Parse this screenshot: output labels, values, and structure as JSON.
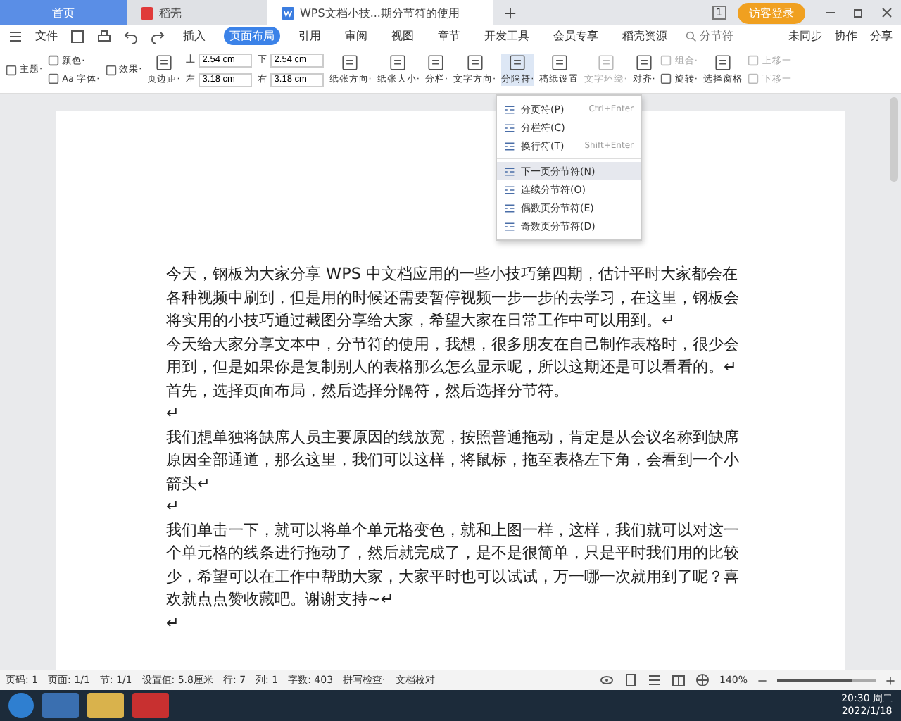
{
  "tabs": [
    {
      "label": "首页",
      "kind": "home",
      "selected": false
    },
    {
      "label": "稻壳",
      "kind": "app",
      "selected": false
    },
    {
      "label": "WPS文档小技...期分节符的使用",
      "kind": "doc",
      "selected": true
    }
  ],
  "title_bar": {
    "page_badge": "1",
    "login": "访客登录"
  },
  "menu_bar": {
    "file": "文件",
    "tabs": [
      {
        "label": "插入",
        "selected": false
      },
      {
        "label": "页面布局",
        "selected": true
      },
      {
        "label": "引用",
        "selected": false
      },
      {
        "label": "审阅",
        "selected": false
      },
      {
        "label": "视图",
        "selected": false
      },
      {
        "label": "章节",
        "selected": false
      },
      {
        "label": "开发工具",
        "selected": false
      },
      {
        "label": "会员专享",
        "selected": false
      },
      {
        "label": "稻壳资源",
        "selected": false
      }
    ],
    "search": {
      "placeholder": "分节符"
    },
    "actions": [
      "未同步",
      "协作",
      "分享"
    ]
  },
  "ribbon": [
    {
      "kind": "stack",
      "items": [
        {
          "label": "主题·",
          "disabled": false
        }
      ]
    },
    {
      "kind": "stack",
      "items": [
        {
          "label": "颜色·",
          "disabled": false
        },
        {
          "label": "Aa 字体·",
          "disabled": false
        }
      ]
    },
    {
      "kind": "stack",
      "items": [
        {
          "label": "效果·",
          "disabled": false
        }
      ]
    },
    {
      "kind": "big",
      "label": "页边距·",
      "disabled": false
    },
    {
      "kind": "spin",
      "items": [
        {
          "label": "上",
          "value": "2.54 cm"
        },
        {
          "label": "左",
          "value": "3.18 cm"
        }
      ]
    },
    {
      "kind": "spin",
      "items": [
        {
          "label": "下",
          "value": "2.54 cm"
        },
        {
          "label": "右",
          "value": "3.18 cm"
        }
      ]
    },
    {
      "kind": "big",
      "label": "纸张方向·",
      "disabled": false
    },
    {
      "kind": "big",
      "label": "纸张大小·",
      "disabled": false
    },
    {
      "kind": "big",
      "label": "分栏·",
      "disabled": false
    },
    {
      "kind": "big",
      "label": "文字方向·",
      "disabled": false
    },
    {
      "kind": "split",
      "label": "分隔符·",
      "disabled": false
    },
    {
      "kind": "big",
      "label": "稿纸设置",
      "disabled": false
    },
    {
      "kind": "big",
      "label": "文字环绕·",
      "disabled": true
    },
    {
      "kind": "big",
      "label": "对齐·",
      "disabled": false
    },
    {
      "kind": "stack",
      "items": [
        {
          "label": "组合·",
          "disabled": true
        },
        {
          "label": "旋转·",
          "disabled": false
        }
      ]
    },
    {
      "kind": "big",
      "label": "选择窗格",
      "disabled": false
    },
    {
      "kind": "stack",
      "items": [
        {
          "label": "上移一",
          "disabled": true
        },
        {
          "label": "下移一",
          "disabled": true
        }
      ]
    }
  ],
  "dropdown": [
    {
      "label": "分页符(P)",
      "shortcut": "Ctrl+Enter",
      "selected": false
    },
    {
      "label": "分栏符(C)",
      "selected": false
    },
    {
      "label": "换行符(T)",
      "shortcut": "Shift+Enter",
      "selected": false
    },
    {
      "label": "下一页分节符(N)",
      "selected": true
    },
    {
      "label": "连续分节符(O)",
      "selected": false
    },
    {
      "label": "偶数页分节符(E)",
      "selected": false
    },
    {
      "label": "奇数页分节符(D)",
      "selected": false
    }
  ],
  "document": {
    "paragraphs": [
      "今天，钢板为大家分享 WPS 中文档应用的一些小技巧第四期，估计平时大家都会在各种视频中刷到，但是用的时候还需要暂停视频一步一步的去学习，在这里，钢板会将实用的小技巧通过截图分享给大家，希望大家在日常工作中可以用到。↵",
      "今天给大家分享文本中，分节符的使用，我想，很多朋友在自己制作表格时，很少会用到，但是如果你是复制别人的表格那么怎么显示呢，所以这期还是可以看看的。↵",
      "首先，选择页面布局，然后选择分隔符，然后选择分节符。",
      "↵",
      "我们想单独将缺席人员主要原因的线放宽，按照普通拖动，肯定是从会议名称到缺席原因全部通道，那么这里，我们可以这样，将鼠标，拖至表格左下角，会看到一个小箭头↵",
      "↵",
      "我们单击一下，就可以将单个单元格变色，就和上图一样，这样，我们就可以对这一个单元格的线条进行拖动了，然后就完成了，是不是很简单，只是平时我们用的比较少，希望可以在工作中帮助大家，大家平时也可以试试，万一哪一次就用到了呢？喜欢就点点赞收藏吧。谢谢支持~↵",
      "↵"
    ]
  },
  "status_bar": {
    "fields": [
      "页码: 1",
      "页面: 1/1",
      "节: 1/1",
      "设置值: 5.8厘米",
      "行: 7",
      "列: 1",
      "字数: 403"
    ],
    "spell_check": "拼写检查·",
    "proofread": "文档校对",
    "zoom": "140%",
    "level": 0.75
  },
  "taskbar": {
    "time": "20:30 周二",
    "date": "2022/1/18"
  }
}
